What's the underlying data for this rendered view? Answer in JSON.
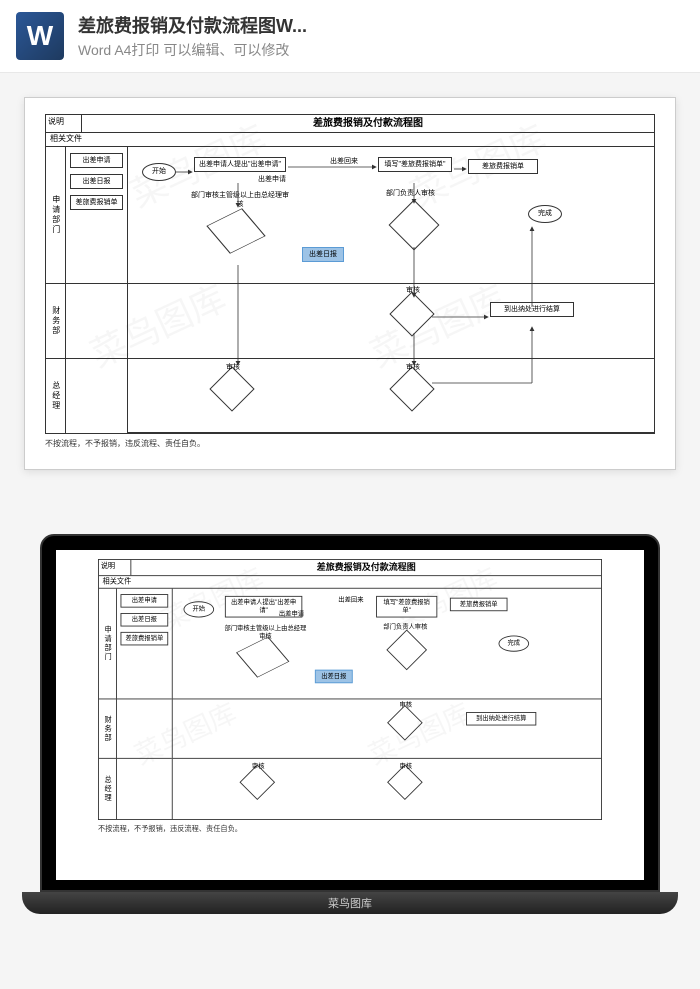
{
  "header": {
    "title": "差旅费报销及付款流程图W...",
    "subtitle": "Word A4打印 可以编辑、可以修改"
  },
  "watermark": "菜鸟图库",
  "flowchart": {
    "header_label": "说明",
    "title": "差旅费报销及付款流程图",
    "docs_label": "相关文件",
    "sections": {
      "s1": "申请部门",
      "s2": "财务部",
      "s3": "总经理"
    },
    "docs": {
      "d1": "出差申请",
      "d2": "出差日报",
      "d3": "差旅费报销单"
    },
    "nodes": {
      "start": "开始",
      "n1": "出差申请人提出\"出差申请\"",
      "n1_note": "出差申请",
      "n2": "部门审核主管级以上由总经理审核",
      "return_note": "出差回来",
      "n3": "填写\"差旅费报销单\"",
      "n3_note": "差旅费报销单",
      "n4": "部门负责人审核",
      "highlight": "出差日报",
      "n5": "审核",
      "n6": "审核",
      "n7": "审核",
      "n8": "到出纳处进行结算",
      "end": "完成"
    },
    "footer": "不按流程，不予报销，违反流程、责任自负。"
  },
  "laptop_brand": "菜鸟图库"
}
